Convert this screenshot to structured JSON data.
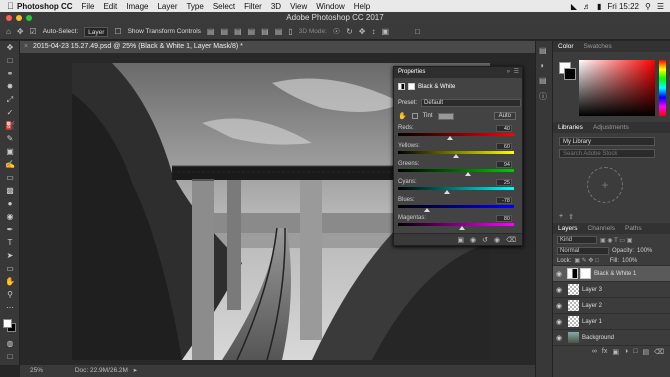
{
  "menubar": {
    "apple": "",
    "app": "Photoshop CC",
    "items": [
      "File",
      "Edit",
      "Image",
      "Layer",
      "Type",
      "Select",
      "Filter",
      "3D",
      "View",
      "Window",
      "Help"
    ],
    "time": "Fri 15:22"
  },
  "window": {
    "title": "Adobe Photoshop CC 2017"
  },
  "options": {
    "auto_select_label": "Auto-Select:",
    "auto_select_value": "Layer",
    "transform_label": "Show Transform Controls",
    "mode_label": "3D Mode:"
  },
  "document": {
    "tab": "2015-04-23 15.27.49.psd @ 25% (Black & White 1, Layer Mask/8) *",
    "zoom": "25%",
    "doc_info": "Doc: 22.9M/26.2M"
  },
  "properties": {
    "header": "Properties",
    "title": "Black & White",
    "preset_label": "Preset:",
    "preset_value": "Default",
    "tint_label": "Tint",
    "auto_label": "Auto",
    "sliders": [
      {
        "name": "Reds:",
        "value": "40",
        "pct": 0.45,
        "gradient": "linear-gradient(90deg,#000,#f00)"
      },
      {
        "name": "Yellows:",
        "value": "60",
        "pct": 0.5,
        "gradient": "linear-gradient(90deg,#000,#ff0)"
      },
      {
        "name": "Greens:",
        "value": "94",
        "pct": 0.6,
        "gradient": "linear-gradient(90deg,#000,#0c0)"
      },
      {
        "name": "Cyans:",
        "value": "25",
        "pct": 0.42,
        "gradient": "linear-gradient(90deg,#000,#0ff)"
      },
      {
        "name": "Blues:",
        "value": "-78",
        "pct": 0.25,
        "gradient": "linear-gradient(90deg,#000,#00f)"
      },
      {
        "name": "Magentas:",
        "value": "80",
        "pct": 0.55,
        "gradient": "linear-gradient(90deg,#000,#f0f)"
      }
    ]
  },
  "color_panel": {
    "tabs": [
      "Color",
      "Swatches"
    ],
    "hue_color": "#ff0000"
  },
  "libraries": {
    "tabs": [
      "Libraries",
      "Adjustments"
    ],
    "library": "My Library",
    "search_placeholder": "Search Adobe Stock"
  },
  "layers": {
    "tabs": [
      "Layers",
      "Channels",
      "Paths"
    ],
    "kind": "Kind",
    "blend": "Normal",
    "opacity_label": "Opacity:",
    "opacity": "100%",
    "lock_label": "Lock:",
    "fill_label": "Fill:",
    "fill": "100%",
    "items": [
      {
        "name": "Black & White 1",
        "type": "adjust",
        "selected": true
      },
      {
        "name": "Layer 3",
        "type": "transparent",
        "selected": false
      },
      {
        "name": "Layer 2",
        "type": "transparent",
        "selected": false
      },
      {
        "name": "Layer 1",
        "type": "transparent",
        "selected": false
      },
      {
        "name": "Background",
        "type": "photo",
        "selected": false
      }
    ]
  }
}
